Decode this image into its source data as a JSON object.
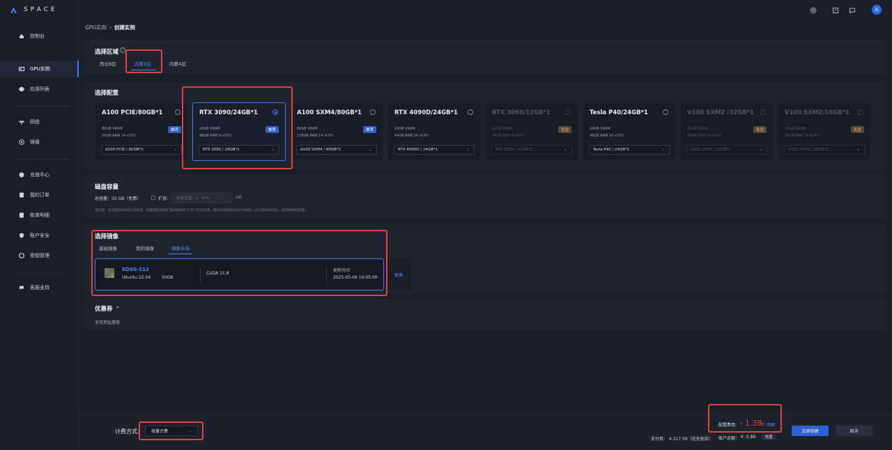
{
  "app": {
    "logo_text": "SPACE",
    "avatar_initial": "A"
  },
  "sidebar": {
    "items": [
      {
        "label": "控制台",
        "icon": "home-icon"
      },
      {
        "label": "GPU实例",
        "icon": "gpu-icon",
        "active": true
      },
      {
        "label": "应用列表",
        "icon": "box-icon"
      },
      {
        "label": "网盘",
        "icon": "network-disk-icon"
      },
      {
        "label": "镜像",
        "icon": "image-icon"
      },
      {
        "label": "充值中心",
        "icon": "recharge-icon"
      },
      {
        "label": "我的订单",
        "icon": "order-icon"
      },
      {
        "label": "账单明细",
        "icon": "bill-icon"
      },
      {
        "label": "账户安全",
        "icon": "shield-icon"
      },
      {
        "label": "密钥管理",
        "icon": "key-icon"
      },
      {
        "label": "客服支持",
        "icon": "chat-icon"
      }
    ]
  },
  "breadcrumb": {
    "parent": "GPU实例",
    "separator": "›",
    "current": "创建实例"
  },
  "region": {
    "title": "选择区域",
    "tabs": [
      "西北B区",
      "内蒙B区",
      "内蒙A区"
    ],
    "active_tab": 1
  },
  "config": {
    "title": "选择配置",
    "cards": [
      {
        "name": "A100 PCIE/80GB*1",
        "spec1": "80GB VRAM",
        "spec2": "50GB RAM 14 vCPU",
        "badge": "推荐",
        "select": "A100 PCIE / 80GB*1",
        "state": "normal"
      },
      {
        "name": "RTX 3090/24GB*1",
        "spec1": "24GB VRAM",
        "spec2": "48GB RAM 8 vCPU",
        "badge": "推荐",
        "select": "RTX 3090 / 24GB*1",
        "state": "selected"
      },
      {
        "name": "A100 SXM4/80GB*1",
        "spec1": "80GB VRAM",
        "spec2": "128GB RAM 14 vCPU",
        "badge": "推荐",
        "select": "A100 SXM4 / 80GB*1",
        "state": "normal"
      },
      {
        "name": "RTX 4090D/24GB*1",
        "spec1": "24GB VRAM",
        "spec2": "64GB RAM 16 vCPU",
        "badge": "",
        "select": "RTX 4090D / 24GB*1",
        "state": "normal"
      },
      {
        "name": "RTX 3060/12GB*1",
        "spec1": "12GB VRAM",
        "spec2": "24GB RAM 8 vCPU",
        "badge": "售罄",
        "select": "RTX 3060 / 12GB*1",
        "state": "disabled"
      },
      {
        "name": "Tesla P40/24GB*1",
        "spec1": "24GB VRAM",
        "spec2": "48GB RAM 10 vCPU",
        "badge": "",
        "select": "Tesla P40 / 24GB*1",
        "state": "normal"
      },
      {
        "name": "V100 SXM2 /32GB*1",
        "spec1": "32GB VRAM",
        "spec2": "88GB RAM 10 vCPU",
        "badge": "售罄",
        "select": "V100 SXM2 / 32GB*1",
        "state": "disabled"
      },
      {
        "name": "V100 SXM2/16GB*1",
        "spec1": "16GB VRAM",
        "spec2": "48GB RAM 16 vCPU",
        "badge": "售罄",
        "select": "V100 SXM2 / 16GB*1",
        "state": "disabled"
      }
    ]
  },
  "disk": {
    "title": "磁盘容量",
    "total_label": "总容量：50 GB（免费）",
    "expand_label": "扩容：",
    "input_placeholder": "容量范围：0 - 974",
    "unit": "GB",
    "note": "说注意：系统盘100GB以内免费，如使用实例的扩容网盘将按 0.01 元/日/GB，每日0点扣费(关机不关机)，过大将影响开机，保存镜像时较慢。"
  },
  "image": {
    "title": "选择镜像",
    "tabs": [
      "基础镜像",
      "我的镜像",
      "镜像市场"
    ],
    "active_tab": 2,
    "selected": {
      "name": "SDXS-512",
      "os": "Ubuntu 22.04",
      "size": "50GB",
      "cuda": "CUDA 11.8",
      "updated_label": "更新时间",
      "updated_value": "2025-05-09 16:05:00"
    },
    "change_label": "更换"
  },
  "coupon": {
    "title": "优惠券",
    "empty": "无可用优惠券"
  },
  "footer": {
    "billing_label": "计费方式:",
    "billing_value": "按量计费",
    "cost_label": "配置费用:",
    "cost_currency": "¥",
    "cost_value": "1.38",
    "cost_unit": "/时",
    "cost_detail": "明细",
    "pay_label": "支付券：",
    "pay_value": "¥ 217.50（优先抵扣）",
    "balance_label": "账户余额：",
    "balance_value": "¥ -5.89",
    "recharge_label": "充值",
    "create_label": "立即创建",
    "cancel_label": "取消"
  },
  "colors": {
    "accent": "#3f7cf5",
    "highlight": "#e5443d",
    "price": "#e5443d"
  }
}
